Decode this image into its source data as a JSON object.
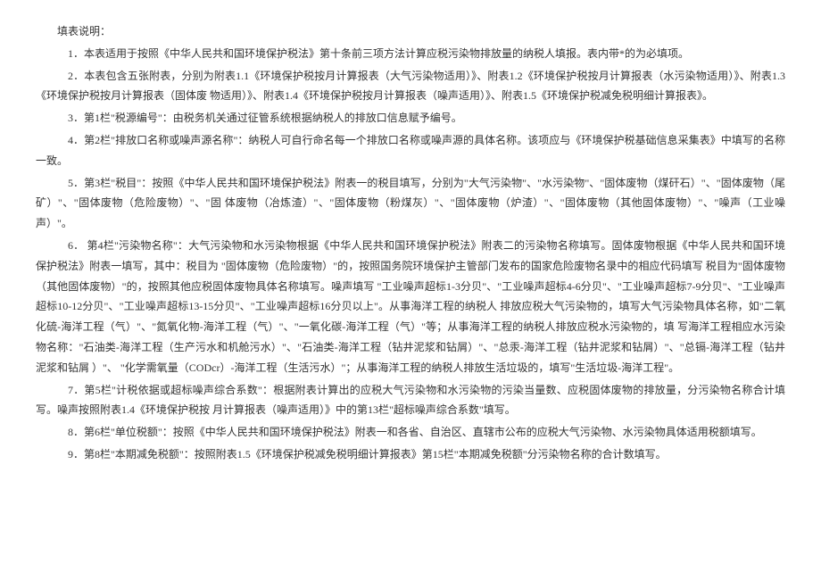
{
  "title": "填表说明：",
  "items": [
    "1．本表适用于按照《中华人民共和国环境保护税法》第十条前三项方法计算应税污染物排放量的纳税人填报。表内带*的为必填项。",
    "2．本表包含五张附表，分别为附表1.1《环境保护税按月计算报表（大气污染物适用）》、附表1.2《环境保护税按月计算报表（水污染物适用）》、附表1.3《环境保护税按月计算报表（固体废  物适用）》、附表1.4《环境保护税按月计算报表（噪声适用）》、附表1.5《环境保护税减免税明细计算报表》。",
    "3．第1栏\"税源编号\"：由税务机关通过征管系统根据纳税人的排放口信息赋予编号。",
    "4．第2栏\"排放口名称或噪声源名称\"：纳税人可自行命名每一个排放口名称或噪声源的具体名称。该项应与《环境保护税基础信息采集表》中填写的名称一致。",
    "5．第3栏\"税目\"：按照《中华人民共和国环境保护税法》附表一的税目填写，分别为\"大气污染物\"、\"水污染物\"、\"固体废物（煤矸石）\"、\"固体废物（尾矿）\"、\"固体废物（危险废物）\"、\"固  体废物（冶炼渣）\"、\"固体废物（粉煤灰）\"、\"固体废物（炉渣）\"、\"固体废物（其他固体废物）\"、\"噪声（工业噪声）\"。",
    "6．  第4栏\"污染物名称\"：大气污染物和水污染物根据《中华人民共和国环境保护税法》附表二的污染物名称填写。固体废物根据《中华人民共和国环境保护税法》附表一填写，其中：税目为  \"固体废物（危险废物）\"的，按照国务院环境保护主管部门发布的国家危险废物名录中的相应代码填写 税目为\"固体废物（其他固体废物）\"的，按照其他应税固体废物具体名称填写。噪声填写  \"工业噪声超标1-3分贝\"、\"工业噪声超标4-6分贝\"、\"工业噪声超标7-9分贝\"、\"工业噪声超标10-12分贝\"、\"工业噪声超标13-15分贝\"、\"工业噪声超标16分贝以上\"。从事海洋工程的纳税人   排放应税大气污染物的，填写大气污染物具体名称，如\"二氧化硫-海洋工程（气）\"、\"氮氧化物-海洋工程（气）\"、\"一氧化碳-海洋工程（气）\"等；从事海洋工程的纳税人排放应税水污染物的，填 写海洋工程相应水污染物名称：\"石油类-海洋工程（生产污水和机舱污水）\"、\"石油类-海洋工程（钻井泥浆和钻屑）\"、\"总汞-海洋工程（钻井泥浆和钻屑）\"、\"总镉-海洋工程（钻井泥浆和钻屑    ）\"、  \"化学需氧量（CODcr）-海洋工程（生活污水）\"；从事海洋工程的纳税人排放生活垃圾的，填写\"生活垃圾-海洋工程\"。",
    "7．第5栏\"计税依据或超标噪声综合系数\"：根据附表计算出的应税大气污染物和水污染物的污染当量数、应税固体废物的排放量，分污染物名称合计填写。噪声按照附表1.4《环境保护税按  月计算报表（噪声适用）》中的第13栏\"超标噪声综合系数\"填写。",
    "8．第6栏\"单位税额\"：按照《中华人民共和国环境保护税法》附表一和各省、自治区、直辖市公布的应税大气污染物、水污染物具体适用税额填写。",
    "9．第8栏\"本期减免税额\"：按照附表1.5《环境保护税减免税明细计算报表》第15栏\"本期减免税额\"分污染物名称的合计数填写。"
  ]
}
